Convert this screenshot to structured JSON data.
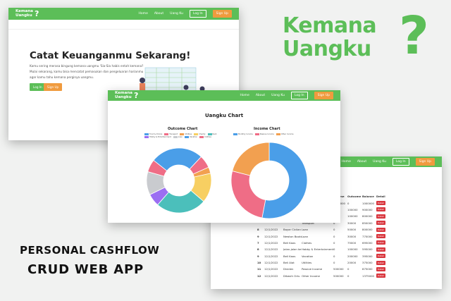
{
  "nav": {
    "logo_line1": "Kemana",
    "logo_line2": "Uangku",
    "logo_q": "?",
    "links": [
      "Home",
      "About",
      "Uang Ku"
    ],
    "login": "Log In",
    "signup": "Sign Up"
  },
  "hero": {
    "title": "Catat Keuanganmu Sekarang!",
    "line1": "Kamu sering merasa bingung kemana uangmu 'Sia-Sia habis entah kemana?",
    "line2": "Mulai sekarang, kamu bisa mencatat pemasukan dan pengeluaran harianmu",
    "line3": "agar kamu tahu kemana perginya uangmu.",
    "btn_login": "Log In",
    "btn_signup": "Sign Up"
  },
  "brand": {
    "line1": "Kemana",
    "line2": "Uangku",
    "q": "?",
    "tagline1": "PERSONAL CASHFLOW",
    "tagline2": "CRUD WEB APP",
    "accent": "#5cbe58",
    "orange": "#f09b3e"
  },
  "charts_page": {
    "title": "Uangku Chart",
    "outcome_title": "Outcome Chart",
    "income_title": "Income Chart"
  },
  "chart_data": [
    {
      "type": "pie",
      "title": "Outcome Chart",
      "categories": [
        "Food & Drinks",
        "Transport",
        "Utilities",
        "Charity",
        "Rent",
        "Hobby & Entertainment",
        "Loan",
        "Vacation",
        "Clothes"
      ],
      "values": [
        25,
        6,
        3,
        14,
        24,
        6,
        11,
        0,
        6
      ],
      "colors": [
        "#4a9ee8",
        "#ef6d86",
        "#f2a050",
        "#f7cf62",
        "#4bbfbb",
        "#9b6ef2",
        "#c9cbcf",
        "#4a9ee8",
        "#ef6d86"
      ],
      "donut": true
    },
    {
      "type": "pie",
      "title": "Income Chart",
      "categories": [
        "Monthly Income",
        "Passive Income",
        "Other Income"
      ],
      "values": [
        53,
        26,
        21
      ],
      "colors": [
        "#4a9ee8",
        "#ef6d86",
        "#f2a050"
      ],
      "donut": true
    }
  ],
  "table": {
    "headers": [
      "",
      "",
      "",
      "Income",
      "Outcome",
      "Balance",
      "Detail"
    ],
    "rows": [
      [
        "",
        "",
        "",
        "1000000",
        "0",
        "1000000",
        "Detail"
      ],
      [
        "",
        "",
        "",
        "0",
        "100000",
        "900000",
        "Detail"
      ],
      [
        "",
        "",
        "",
        "0",
        "100000",
        "800000",
        "Detail"
      ],
      [
        "",
        "",
        "Transport",
        "0",
        "30000",
        "850000",
        "Detail"
      ],
      [
        "8",
        "12/1/2022",
        "Loan",
        "0",
        "50000",
        "800000",
        "Detail"
      ],
      [
        "9",
        "12/1/2022",
        "Loan",
        "0",
        "30000",
        "770000",
        "Detail"
      ],
      [
        "7",
        "12/1/2022",
        "Clothes",
        "0",
        "75000",
        "695000",
        "Detail"
      ],
      [
        "8",
        "12/1/2022",
        "Hobby & Entertainment",
        "0",
        "100000",
        "595000",
        "Detail"
      ],
      [
        "9",
        "12/1/2022",
        "Vacation",
        "0",
        "200000",
        "395000",
        "Detail"
      ],
      [
        "10",
        "12/1/2022",
        "Utilities",
        "0",
        "20000",
        "375000",
        "Detail"
      ],
      [
        "11",
        "12/1/2022",
        "Passive Income",
        "500000",
        "0",
        "875000",
        "Detail"
      ],
      [
        "12",
        "12/1/2022",
        "Other Income",
        "500000",
        "0",
        "1375000",
        "Detail"
      ]
    ],
    "descs": [
      "",
      "",
      "",
      "",
      "Bayar Cicilan Laptop",
      "Newton Bootcamp",
      "Beli Kaos",
      "Jalan-jalan ke Pantai",
      "Beli Kaos",
      "Beli Alat",
      "Dividen",
      "Dikasih Ortu"
    ]
  }
}
